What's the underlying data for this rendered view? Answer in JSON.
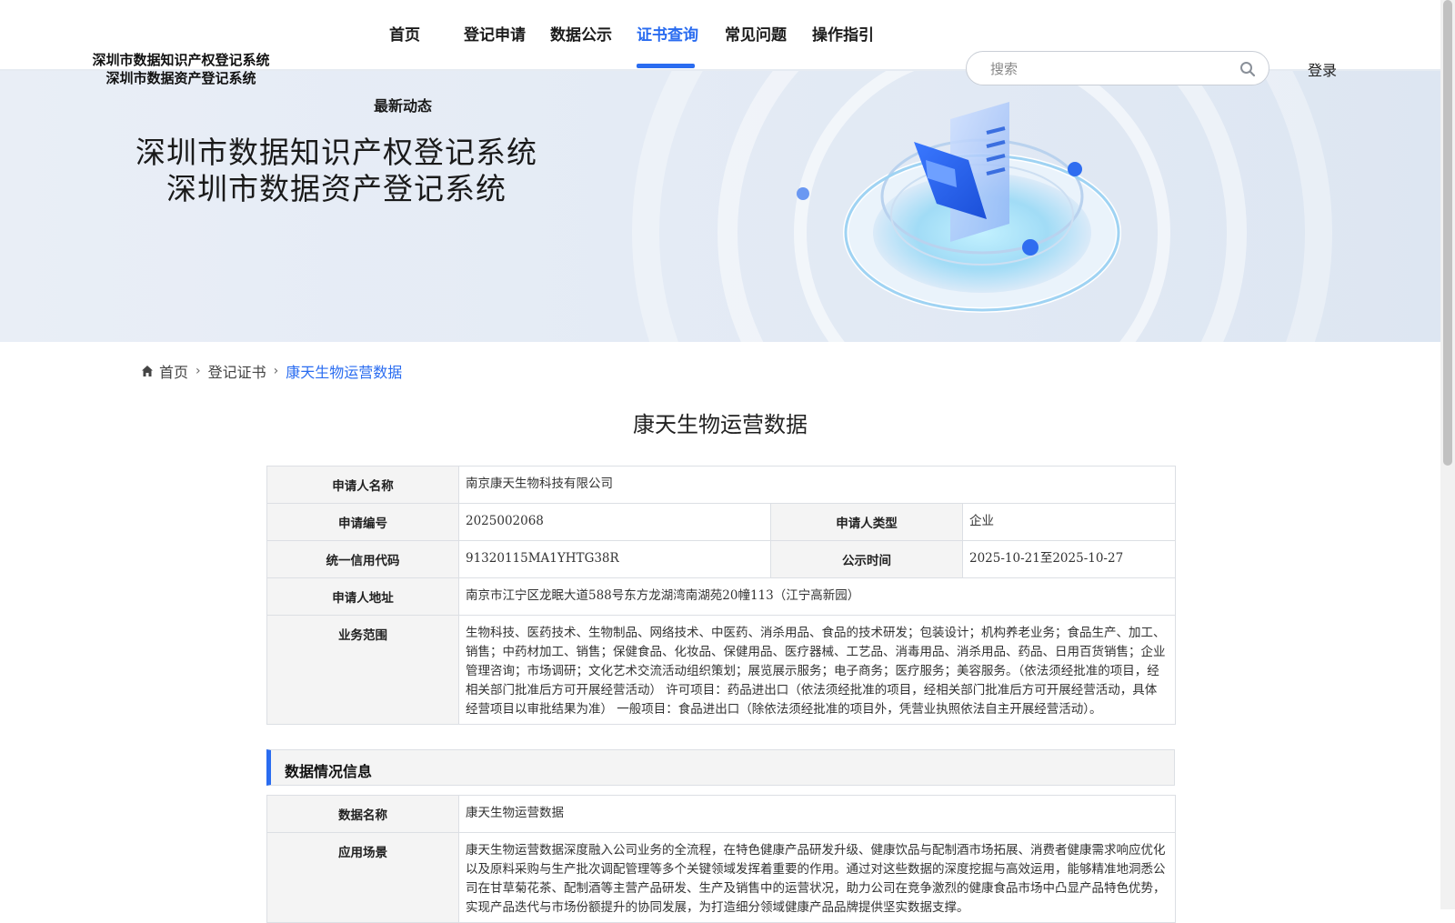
{
  "header": {
    "logo_line1": "深圳市数据知识产权登记系统",
    "logo_line2": "深圳市数据资产登记系统",
    "nav": {
      "home": "首页",
      "register": "登记申请",
      "publicity": "数据公示",
      "certificate": "证书查询",
      "faq": "常见问题",
      "guide": "操作指引",
      "news": "最新动态"
    },
    "active_nav": "证书查询",
    "search_placeholder": "搜索",
    "login": "登录",
    "accent_color": "#2a6cf0"
  },
  "banner": {
    "title_line1": "深圳市数据知识产权登记系统",
    "title_line2": "深圳市数据资产登记系统"
  },
  "breadcrumb": {
    "home": "首页",
    "level2": "登记证书",
    "current": "康天生物运营数据"
  },
  "page_title": "康天生物运营数据",
  "applicant": {
    "name_label": "申请人名称",
    "name": "南京康天生物科技有限公司",
    "number_label": "申请编号",
    "number": "2025002068",
    "type_label": "申请人类型",
    "type": "企业",
    "credit_label": "统一信用代码",
    "credit_code": "91320115MA1YHTG38R",
    "publicity_label": "公示时间",
    "publicity_time": "2025-10-21至2025-10-27",
    "address_label": "申请人地址",
    "address": "南京市江宁区龙眠大道588号东方龙湖湾南湖苑20幢113（江宁高新园）",
    "scope_label": "业务范围",
    "scope": "生物科技、医药技术、生物制品、网络技术、中医药、消杀用品、食品的技术研发；包装设计；机构养老业务；食品生产、加工、销售；中药材加工、销售；保健食品、化妆品、保健用品、医疗器械、工艺品、消毒用品、消杀用品、药品、日用百货销售；企业管理咨询；市场调研；文化艺术交流活动组织策划；展览展示服务；电子商务；医疗服务；美容服务。（依法须经批准的项目，经相关部门批准后方可开展经营活动） 许可项目：药品进出口（依法须经批准的项目，经相关部门批准后方可开展经营活动，具体经营项目以审批结果为准） 一般项目：食品进出口（除依法须经批准的项目外，凭营业执照依法自主开展经营活动）。"
  },
  "data_section": {
    "heading": "数据情况信息",
    "name_label": "数据名称",
    "name": "康天生物运营数据",
    "scenario_label": "应用场景",
    "scenario": "康天生物运营数据深度融入公司业务的全流程，在特色健康产品研发升级、健康饮品与配制酒市场拓展、消费者健康需求响应优化以及原料采购与生产批次调配管理等多个关键领域发挥着重要的作用。通过对这些数据的深度挖掘与高效运用，能够精准地洞悉公司在甘草菊花茶、配制酒等主营产品研发、生产及销售中的运营状况，助力公司在竞争激烈的健康食品市场中凸显产品特色优势，实现产品迭代与市场份额提升的协同发展，为打造细分领域健康产品品牌提供坚实数据支撑。"
  }
}
